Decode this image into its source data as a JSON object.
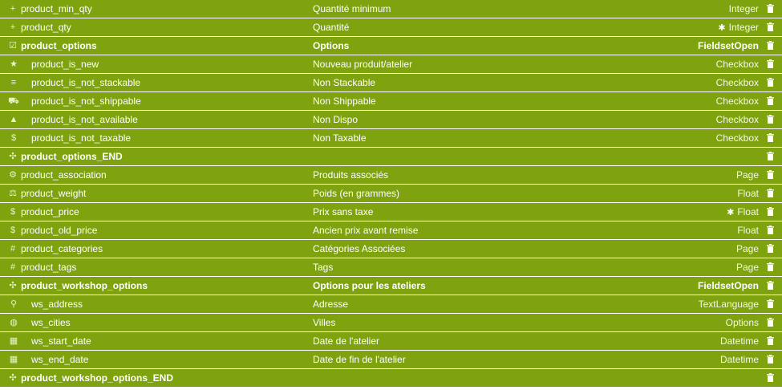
{
  "rows": [
    {
      "icon": "plus-icon",
      "glyph": "+",
      "name": "product_min_qty",
      "label": "Quantité minimum",
      "type": "Integer",
      "required": false,
      "bold": false,
      "child": false
    },
    {
      "icon": "plus-icon",
      "glyph": "+",
      "name": "product_qty",
      "label": "Quantité",
      "type": "Integer",
      "required": true,
      "bold": false,
      "child": false
    },
    {
      "icon": "checkbox-icon",
      "glyph": "☑",
      "name": "product_options",
      "label": "Options",
      "type": "FieldsetOpen",
      "required": false,
      "bold": true,
      "child": false
    },
    {
      "icon": "star-icon",
      "glyph": "★",
      "name": "product_is_new",
      "label": "Nouveau produit/atelier",
      "type": "Checkbox",
      "required": false,
      "bold": false,
      "child": true
    },
    {
      "icon": "list-icon",
      "glyph": "≡",
      "name": "product_is_not_stackable",
      "label": "Non Stackable",
      "type": "Checkbox",
      "required": false,
      "bold": false,
      "child": true
    },
    {
      "icon": "truck-icon",
      "glyph": "⛟",
      "name": "product_is_not_shippable",
      "label": "Non Shippable",
      "type": "Checkbox",
      "required": false,
      "bold": false,
      "child": true
    },
    {
      "icon": "warning-icon",
      "glyph": "▲",
      "name": "product_is_not_available",
      "label": "Non Dispo",
      "type": "Checkbox",
      "required": false,
      "bold": false,
      "child": true
    },
    {
      "icon": "dollar-icon",
      "glyph": "$",
      "name": "product_is_not_taxable",
      "label": "Non Taxable",
      "type": "Checkbox",
      "required": false,
      "bold": false,
      "child": true
    },
    {
      "icon": "move-icon",
      "glyph": "✣",
      "name": "product_options_END",
      "label": "",
      "type": "",
      "required": false,
      "bold": true,
      "child": false
    },
    {
      "icon": "cogs-icon",
      "glyph": "⚙",
      "name": "product_association",
      "label": "Produits associés",
      "type": "Page",
      "required": false,
      "bold": false,
      "child": false
    },
    {
      "icon": "scale-icon",
      "glyph": "⚖",
      "name": "product_weight",
      "label": "Poids (en grammes)",
      "type": "Float",
      "required": false,
      "bold": false,
      "child": false
    },
    {
      "icon": "dollar-icon",
      "glyph": "$",
      "name": "product_price",
      "label": "Prix sans taxe",
      "type": "Float",
      "required": true,
      "bold": false,
      "child": false
    },
    {
      "icon": "dollar-icon",
      "glyph": "$",
      "name": "product_old_price",
      "label": "Ancien prix avant remise",
      "type": "Float",
      "required": false,
      "bold": false,
      "child": false
    },
    {
      "icon": "hash-icon",
      "glyph": "#",
      "name": "product_categories",
      "label": "Catégories Associées",
      "type": "Page",
      "required": false,
      "bold": false,
      "child": false
    },
    {
      "icon": "hash-icon",
      "glyph": "#",
      "name": "product_tags",
      "label": "Tags",
      "type": "Page",
      "required": false,
      "bold": false,
      "child": false
    },
    {
      "icon": "move-icon",
      "glyph": "✣",
      "name": "product_workshop_options",
      "label": "Options pour les ateliers",
      "type": "FieldsetOpen",
      "required": false,
      "bold": true,
      "child": false
    },
    {
      "icon": "map-marker-icon",
      "glyph": "⚲",
      "name": "ws_address",
      "label": "Adresse",
      "type": "TextLanguage",
      "required": false,
      "bold": false,
      "child": true
    },
    {
      "icon": "globe-icon",
      "glyph": "◍",
      "name": "ws_cities",
      "label": "Villes",
      "type": "Options",
      "required": false,
      "bold": false,
      "child": true
    },
    {
      "icon": "calendar-icon",
      "glyph": "▦",
      "name": "ws_start_date",
      "label": "Date de l'atelier",
      "type": "Datetime",
      "required": false,
      "bold": false,
      "child": true
    },
    {
      "icon": "calendar-icon",
      "glyph": "▦",
      "name": "ws_end_date",
      "label": "Date de fin de l'atelier",
      "type": "Datetime",
      "required": false,
      "bold": false,
      "child": true
    },
    {
      "icon": "move-icon",
      "glyph": "✣",
      "name": "product_workshop_options_END",
      "label": "",
      "type": "",
      "required": false,
      "bold": true,
      "child": false
    }
  ],
  "required_glyph": "✱",
  "colors": {
    "row_bg": "#7fa30f",
    "text": "#ffffff"
  }
}
